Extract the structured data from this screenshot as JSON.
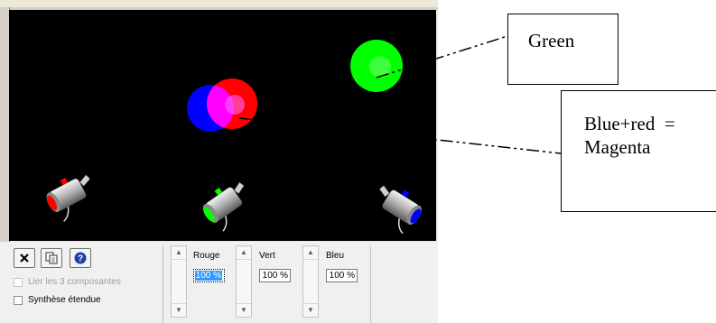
{
  "stage": {
    "background": "#000000",
    "lights": [
      {
        "name": "red",
        "color": "#ff0000"
      },
      {
        "name": "green",
        "color": "#00ff00"
      },
      {
        "name": "blue",
        "color": "#0000ff"
      }
    ],
    "mix_color": "#ff00ff"
  },
  "toolbar": {
    "close_icon": "close-icon",
    "copy_icon": "copy-icon",
    "help_icon": "help-icon"
  },
  "options": {
    "link_label": "Lier les 3 composantes",
    "link_checked": false,
    "link_enabled": false,
    "extended_label": "Synthèse étendue",
    "extended_checked": false
  },
  "channels": [
    {
      "label": "Rouge",
      "value": "100 %"
    },
    {
      "label": "Vert",
      "value": "100 %"
    },
    {
      "label": "Bleu",
      "value": "100 %"
    }
  ],
  "annotations": {
    "green_label": "Green",
    "magenta_line1": "Blue+red  =",
    "magenta_line2": "Magenta"
  }
}
